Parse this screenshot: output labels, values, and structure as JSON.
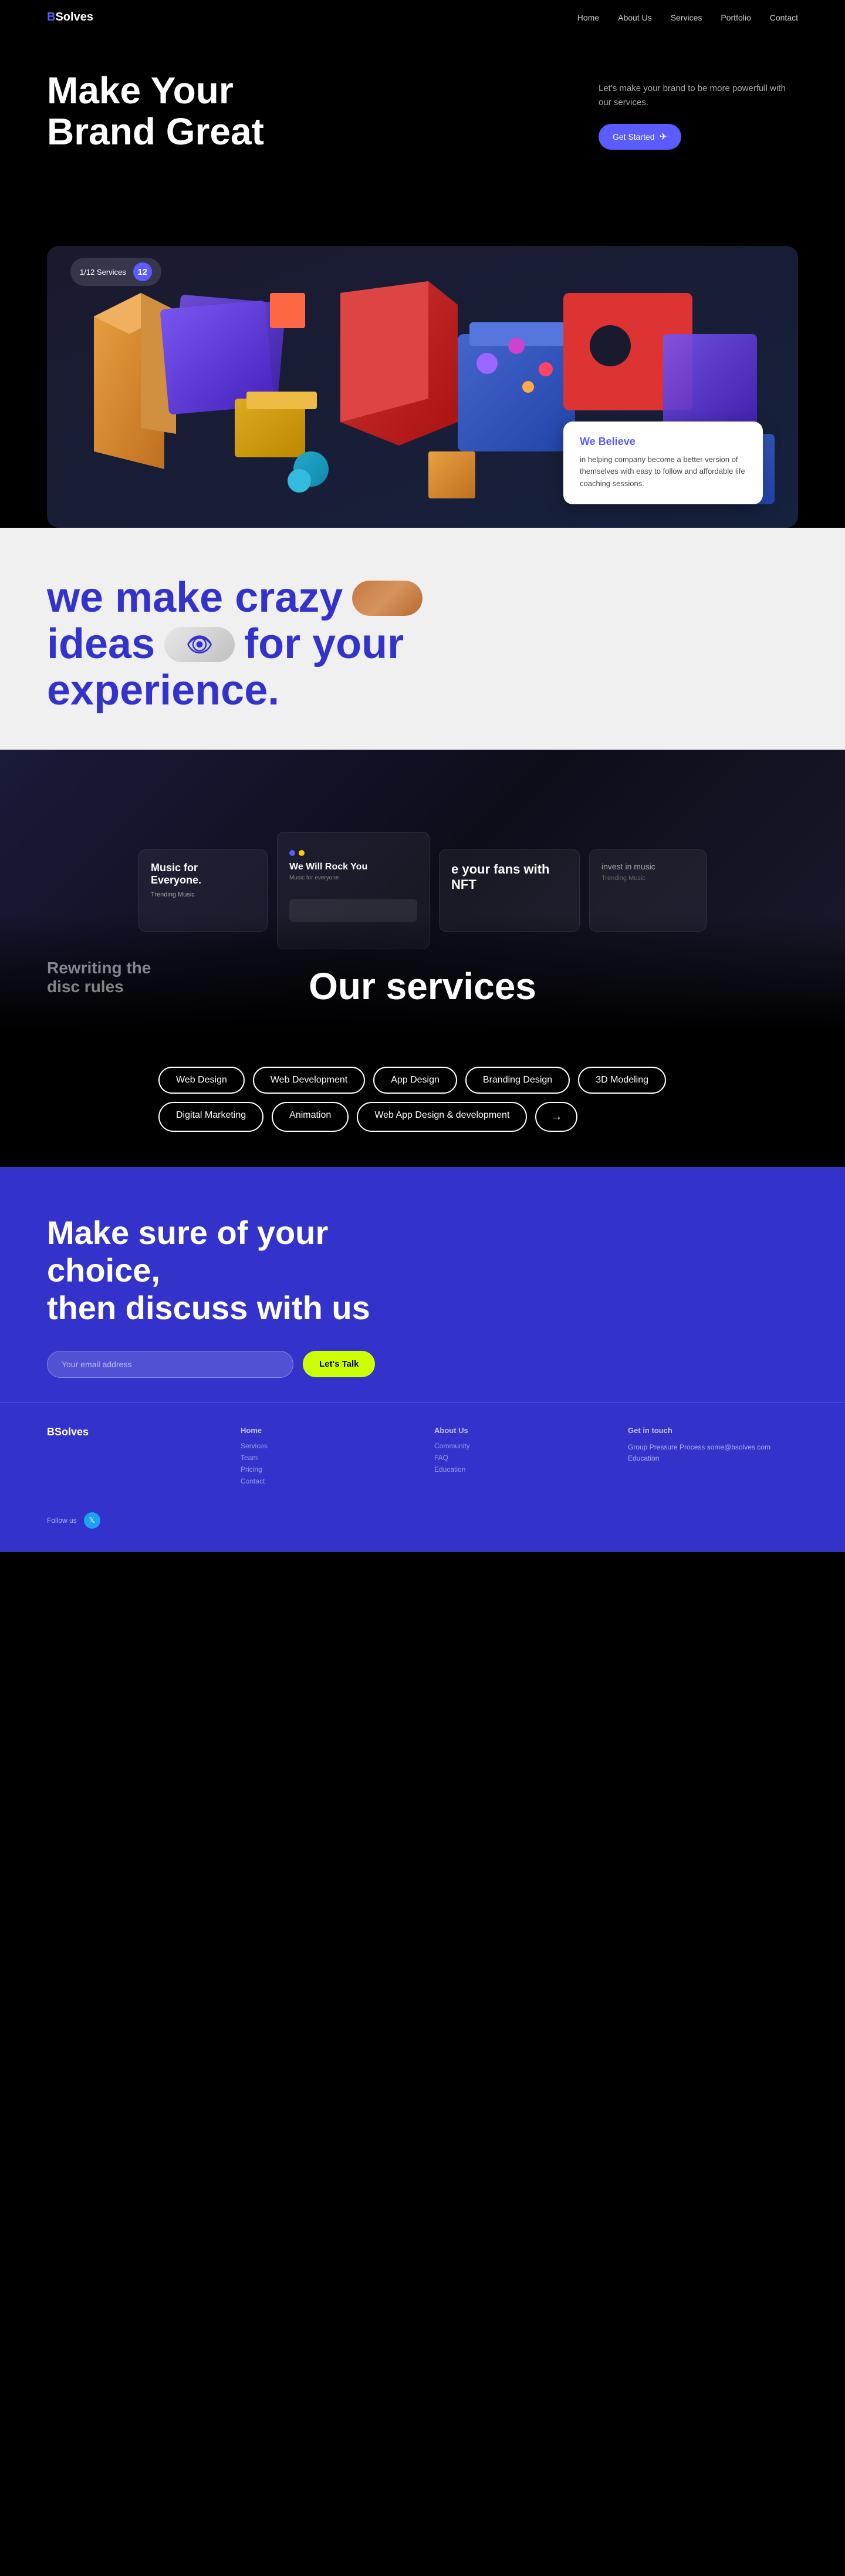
{
  "nav": {
    "logo_prefix": "B",
    "logo_suffix": "Solves",
    "links": [
      "Home",
      "About Us",
      "Services",
      "Portfolio",
      "Contact"
    ]
  },
  "hero": {
    "title": "Make Your Brand Great",
    "subtitle": "Let's make your brand to be more powerfull with our services.",
    "cta_label": "Get Started",
    "cta_arrow": "✈"
  },
  "services_badge": {
    "label": "1/12 Services",
    "number": "12"
  },
  "believe_card": {
    "heading": "We Believe",
    "text": "in helping company become a better version of themselves with easy to follow and affordable life coaching sessions."
  },
  "tagline": {
    "line1": "we make crazy",
    "line2_a": "ideas",
    "line2_b": "for your",
    "line3": "experience."
  },
  "services_section": {
    "title": "Our services",
    "tags": [
      "Web Design",
      "Web Development",
      "App Design",
      "Branding Design",
      "3D Modeling",
      "Digital Marketing",
      "Animation",
      "Web App Design & development"
    ]
  },
  "cta": {
    "title_line1": "Make sure of your choice,",
    "title_line2": "then discuss with us",
    "email_placeholder": "Your email address",
    "btn_label": "Let's Talk"
  },
  "footer": {
    "logo": "BSolves",
    "col1_title": "Home",
    "col1_links": [
      "Services",
      "Team",
      "Pricing",
      "Contact"
    ],
    "col2_title": "About Us",
    "col2_links": [
      "Community",
      "FAQ",
      "Education"
    ],
    "col3_title": "Get in touch",
    "col3_text": "Group Pressure Process\nsome@bsolves.com\nEducation",
    "follow_label": "Follow us"
  }
}
